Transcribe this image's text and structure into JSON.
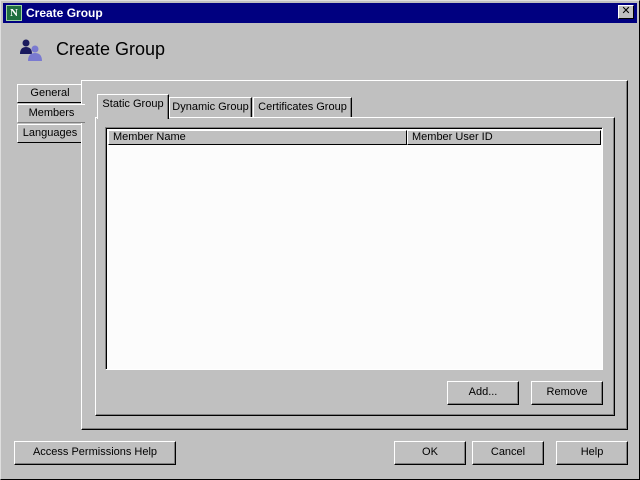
{
  "window": {
    "title": "Create Group",
    "app_icon_label": "N",
    "close_symbol": "✕"
  },
  "header": {
    "title": "Create Group",
    "icon": "group-icon"
  },
  "side_tabs": [
    {
      "label": "General",
      "active": false
    },
    {
      "label": "Members",
      "active": true
    },
    {
      "label": "Languages",
      "active": false
    }
  ],
  "top_tabs": [
    {
      "label": "Static Group",
      "active": true
    },
    {
      "label": "Dynamic Group",
      "active": false
    },
    {
      "label": "Certificates Group",
      "active": false
    }
  ],
  "table": {
    "columns": [
      "Member Name",
      "Member User ID"
    ],
    "rows": []
  },
  "table_buttons": {
    "add": "Add...",
    "remove": "Remove"
  },
  "footer": {
    "access_help": "Access Permissions Help",
    "ok": "OK",
    "cancel": "Cancel",
    "help": "Help"
  },
  "colors": {
    "titlebar": "#000080",
    "dialog_bg": "#c0c0c0",
    "list_bg": "#fcfcfc"
  }
}
